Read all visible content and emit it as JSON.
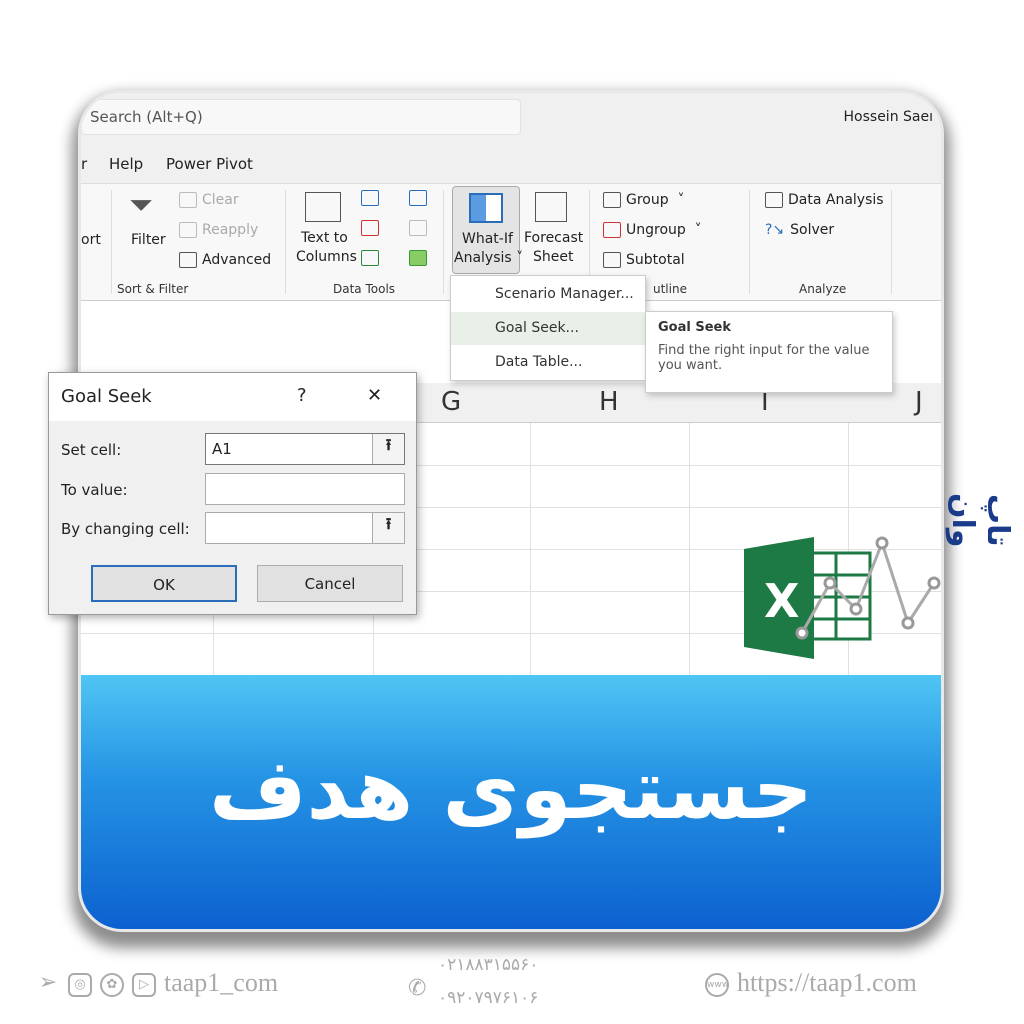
{
  "excel": {
    "search_placeholder": "Search (Alt+Q)",
    "user": "Hossein Saeı",
    "tabs": [
      "r",
      "Help",
      "Power Pivot"
    ],
    "ribbon": {
      "sort_partial": "ort",
      "filter": "Filter",
      "clear": "Clear",
      "reapply": "Reapply",
      "advanced": "Advanced",
      "text_to": "Text to",
      "columns": "Columns",
      "whatif1": "What-If",
      "whatif2": "Analysis ˅",
      "forecast1": "Forecast",
      "forecast2": "Sheet",
      "group": "Group",
      "ungroup": "Ungroup",
      "subtotal": "Subtotal",
      "data_analysis": "Data Analysis",
      "solver": "Solver",
      "groups": {
        "sort_filter": "Sort & Filter",
        "data_tools": "Data Tools",
        "outline": "utline",
        "analyze": "Analyze"
      }
    },
    "menu": [
      "Scenario Manager...",
      "Goal Seek...",
      "Data Table..."
    ],
    "tooltip": {
      "title": "Goal Seek",
      "body": "Find the right input for the value you want."
    },
    "columns": [
      "G",
      "H",
      "I",
      "J"
    ],
    "dialog": {
      "title": "Goal Seek",
      "help": "?",
      "close": "✕",
      "set_cell_label": "Set cell:",
      "set_cell_value": "A1",
      "to_value_label": "To value:",
      "to_value_value": "",
      "changing_label": "By changing cell:",
      "changing_value": "",
      "ok": "OK",
      "cancel": "Cancel"
    }
  },
  "banner_title": "جستجوی هدف",
  "brand": "تاپ وان",
  "footer": {
    "social": "taap1_com",
    "phone1": "۰۲۱۸۸۳۱۵۵۶۰",
    "phone2": "۰۹۲۰۷۹۷۶۱۰۶",
    "website": "https://taap1.com"
  },
  "colors": {
    "banner_top": "#4fc6f4",
    "banner_bottom": "#0b5fcf",
    "excel_green": "#1d7a45",
    "brand": "#1a3a8a"
  }
}
